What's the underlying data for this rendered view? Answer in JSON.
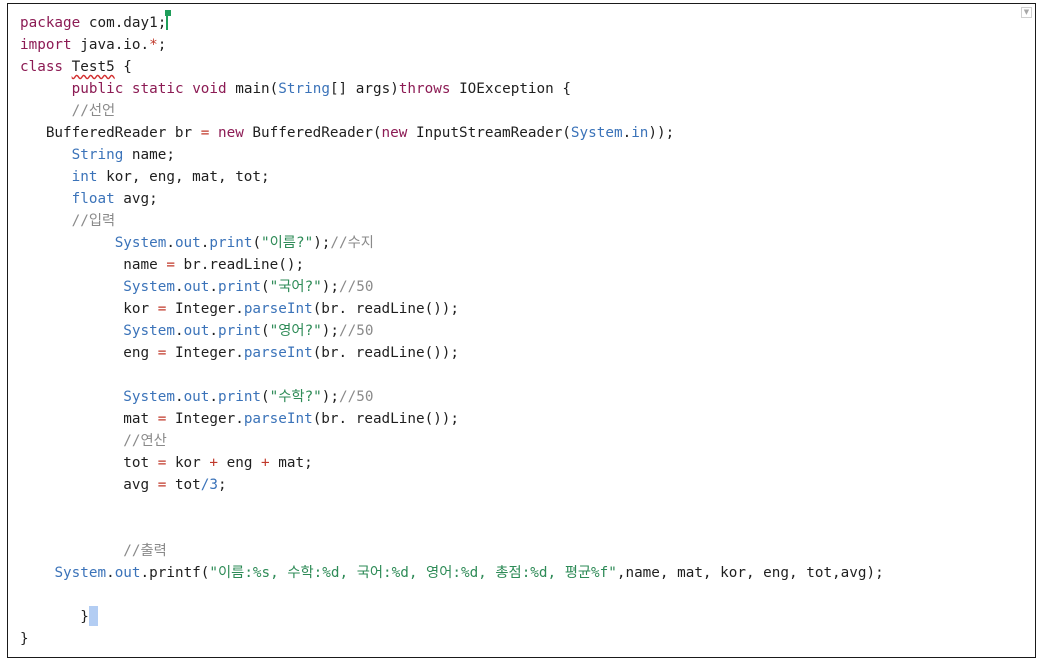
{
  "editor": {
    "lines": [
      [
        {
          "t": "package",
          "c": "kw"
        },
        {
          "t": " com.day1;"
        },
        {
          "cursor": "green"
        }
      ],
      [
        {
          "t": "import",
          "c": "kw"
        },
        {
          "t": " java.io."
        },
        {
          "t": "*",
          "c": "op"
        },
        {
          "t": ";"
        }
      ],
      [
        {
          "t": "class",
          "c": "kw"
        },
        {
          "t": " "
        },
        {
          "t": "Test5",
          "squiggle": true
        },
        {
          "t": " {"
        }
      ],
      [
        {
          "t": "      "
        },
        {
          "t": "public",
          "c": "kw"
        },
        {
          "t": " "
        },
        {
          "t": "static",
          "c": "kw"
        },
        {
          "t": " "
        },
        {
          "t": "void",
          "c": "kw"
        },
        {
          "t": " main("
        },
        {
          "t": "String",
          "c": "ty"
        },
        {
          "t": "[] args)"
        },
        {
          "t": "throws",
          "c": "kw"
        },
        {
          "t": " IOException {"
        }
      ],
      [
        {
          "t": "      "
        },
        {
          "t": "//선언",
          "c": "cm"
        }
      ],
      [
        {
          "t": "   BufferedReader br "
        },
        {
          "t": "=",
          "c": "op"
        },
        {
          "t": " "
        },
        {
          "t": "new",
          "c": "kw"
        },
        {
          "t": " BufferedReader("
        },
        {
          "t": "new",
          "c": "kw"
        },
        {
          "t": " InputStreamReader("
        },
        {
          "t": "System",
          "c": "ty"
        },
        {
          "t": "."
        },
        {
          "t": "in",
          "c": "fn"
        },
        {
          "t": "));"
        }
      ],
      [
        {
          "t": "      "
        },
        {
          "t": "String",
          "c": "ty"
        },
        {
          "t": " name;"
        }
      ],
      [
        {
          "t": "      "
        },
        {
          "t": "int",
          "c": "ty"
        },
        {
          "t": " kor, eng, mat, tot;"
        }
      ],
      [
        {
          "t": "      "
        },
        {
          "t": "float",
          "c": "ty"
        },
        {
          "t": " avg;"
        }
      ],
      [
        {
          "t": "      "
        },
        {
          "t": "//입력",
          "c": "cm"
        }
      ],
      [
        {
          "t": "           "
        },
        {
          "t": "System",
          "c": "ty"
        },
        {
          "t": "."
        },
        {
          "t": "out",
          "c": "fn"
        },
        {
          "t": "."
        },
        {
          "t": "print",
          "c": "fn"
        },
        {
          "t": "("
        },
        {
          "t": "\"이름?\"",
          "c": "st"
        },
        {
          "t": ");"
        },
        {
          "t": "//수지",
          "c": "cm"
        }
      ],
      [
        {
          "t": "            name "
        },
        {
          "t": "=",
          "c": "op"
        },
        {
          "t": " br.readLine();"
        }
      ],
      [
        {
          "t": "            "
        },
        {
          "t": "System",
          "c": "ty"
        },
        {
          "t": "."
        },
        {
          "t": "out",
          "c": "fn"
        },
        {
          "t": "."
        },
        {
          "t": "print",
          "c": "fn"
        },
        {
          "t": "("
        },
        {
          "t": "\"국어?\"",
          "c": "st"
        },
        {
          "t": ");"
        },
        {
          "t": "//50",
          "c": "cm"
        }
      ],
      [
        {
          "t": "            kor "
        },
        {
          "t": "=",
          "c": "op"
        },
        {
          "t": " Integer."
        },
        {
          "t": "parseInt",
          "c": "fn"
        },
        {
          "t": "(br. readLine());"
        }
      ],
      [
        {
          "t": "            "
        },
        {
          "t": "System",
          "c": "ty"
        },
        {
          "t": "."
        },
        {
          "t": "out",
          "c": "fn"
        },
        {
          "t": "."
        },
        {
          "t": "print",
          "c": "fn"
        },
        {
          "t": "("
        },
        {
          "t": "\"영어?\"",
          "c": "st"
        },
        {
          "t": ");"
        },
        {
          "t": "//50",
          "c": "cm"
        }
      ],
      [
        {
          "t": "            eng "
        },
        {
          "t": "=",
          "c": "op"
        },
        {
          "t": " Integer."
        },
        {
          "t": "parseInt",
          "c": "fn"
        },
        {
          "t": "(br. readLine());"
        }
      ],
      [],
      [
        {
          "t": "            "
        },
        {
          "t": "System",
          "c": "ty"
        },
        {
          "t": "."
        },
        {
          "t": "out",
          "c": "fn"
        },
        {
          "t": "."
        },
        {
          "t": "print",
          "c": "fn"
        },
        {
          "t": "("
        },
        {
          "t": "\"수학?\"",
          "c": "st"
        },
        {
          "t": ");"
        },
        {
          "t": "//50",
          "c": "cm"
        }
      ],
      [
        {
          "t": "            mat "
        },
        {
          "t": "=",
          "c": "op"
        },
        {
          "t": " Integer."
        },
        {
          "t": "parseInt",
          "c": "fn"
        },
        {
          "t": "(br. readLine());"
        }
      ],
      [
        {
          "t": "            "
        },
        {
          "t": "//연산",
          "c": "cm"
        }
      ],
      [
        {
          "t": "            tot "
        },
        {
          "t": "=",
          "c": "op"
        },
        {
          "t": " kor "
        },
        {
          "t": "+",
          "c": "op"
        },
        {
          "t": " eng "
        },
        {
          "t": "+",
          "c": "op"
        },
        {
          "t": " mat;"
        }
      ],
      [
        {
          "t": "            avg "
        },
        {
          "t": "=",
          "c": "op"
        },
        {
          "t": " tot"
        },
        {
          "t": "/3",
          "c": "fn"
        },
        {
          "t": ";"
        }
      ],
      [],
      [],
      [
        {
          "t": "            "
        },
        {
          "t": "//출력",
          "c": "cm"
        }
      ],
      [
        {
          "t": "    "
        },
        {
          "t": "System",
          "c": "ty"
        },
        {
          "t": "."
        },
        {
          "t": "out",
          "c": "fn"
        },
        {
          "t": ".printf("
        },
        {
          "t": "\"이름:%s, 수학:%d, 국어:%d, 영어:%d, 총점:%d, 평균%f\"",
          "c": "st"
        },
        {
          "t": ",name, mat, kor, eng, tot,avg);"
        }
      ],
      [],
      [
        {
          "t": "       }"
        },
        {
          "cursor": "blue"
        }
      ],
      [
        {
          "t": "}"
        }
      ]
    ]
  }
}
